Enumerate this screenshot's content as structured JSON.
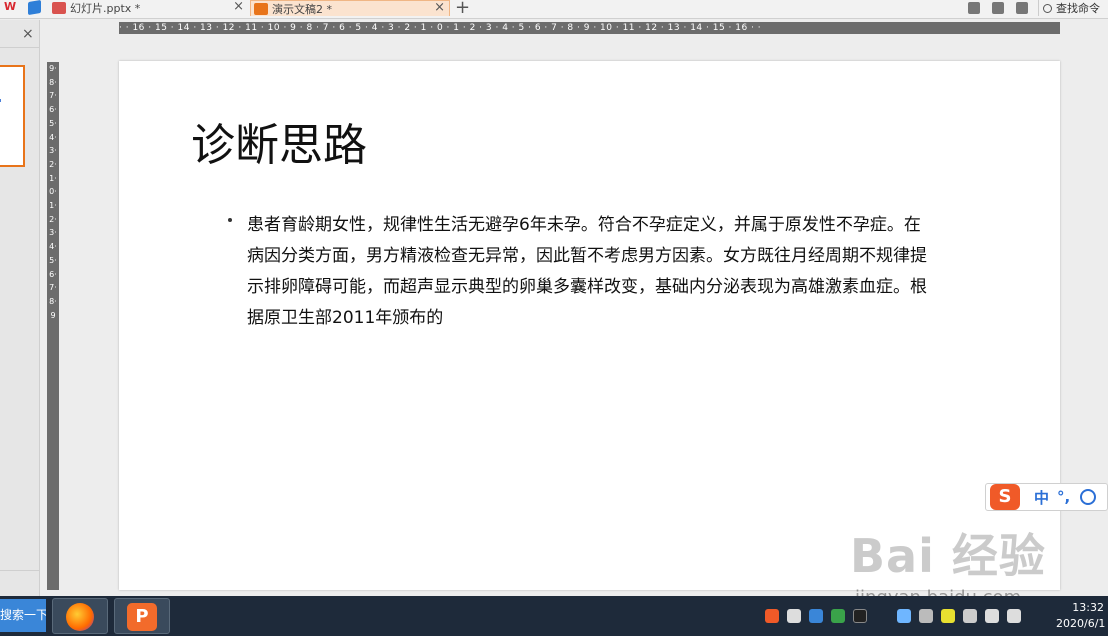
{
  "tabs": [
    {
      "label": "幻灯片.pptx *",
      "active": false
    },
    {
      "label": "演示文稿2 *",
      "active": true
    }
  ],
  "toolbar": {
    "search_command": "查找命令"
  },
  "ruler": {
    "horizontal": "· · 16 · 15 · 14 · 13 · 12 · 11 · 10 · 9 · 8 · 7 · 6 · 5 · 4 · 3 · 2 · 1 · 0 · 1 · 2 · 3 · 4 · 5 · 6 · 7 · 8 · 9 · 10 · 11 · 12 · 13 · 14 · 15 · 16 · ·",
    "vertical": "9·8·7·6·5·4·3·2·1·0·1·2·3·4·5·6·7·8·9"
  },
  "slide": {
    "title": "诊断思路",
    "bullet": "患者育龄期女性，规律性生活无避孕6年未孕。符合不孕症定义，并属于原发性不孕症。在病因分类方面，男方精液检查无异常，因此暂不考虑男方因素。女方既往月经周期不规律提示排卵障碍可能，而超声显示典型的卵巢多囊样改变，基础内分泌表现为高雄激素血症。根据原卫生部2011年颁布的"
  },
  "ime": {
    "logo": "S",
    "mode": "中",
    "punct": "°,"
  },
  "watermark": {
    "logo": "Bai 经验",
    "url": "jingyan.baidu.com"
  },
  "taskbar": {
    "search_label": "搜索一下",
    "time": "13:32",
    "date": "2020/6/1"
  },
  "colors": {
    "accent": "#e8741a",
    "ime": "#f05a28",
    "taskbar": "#1e2a3a"
  }
}
